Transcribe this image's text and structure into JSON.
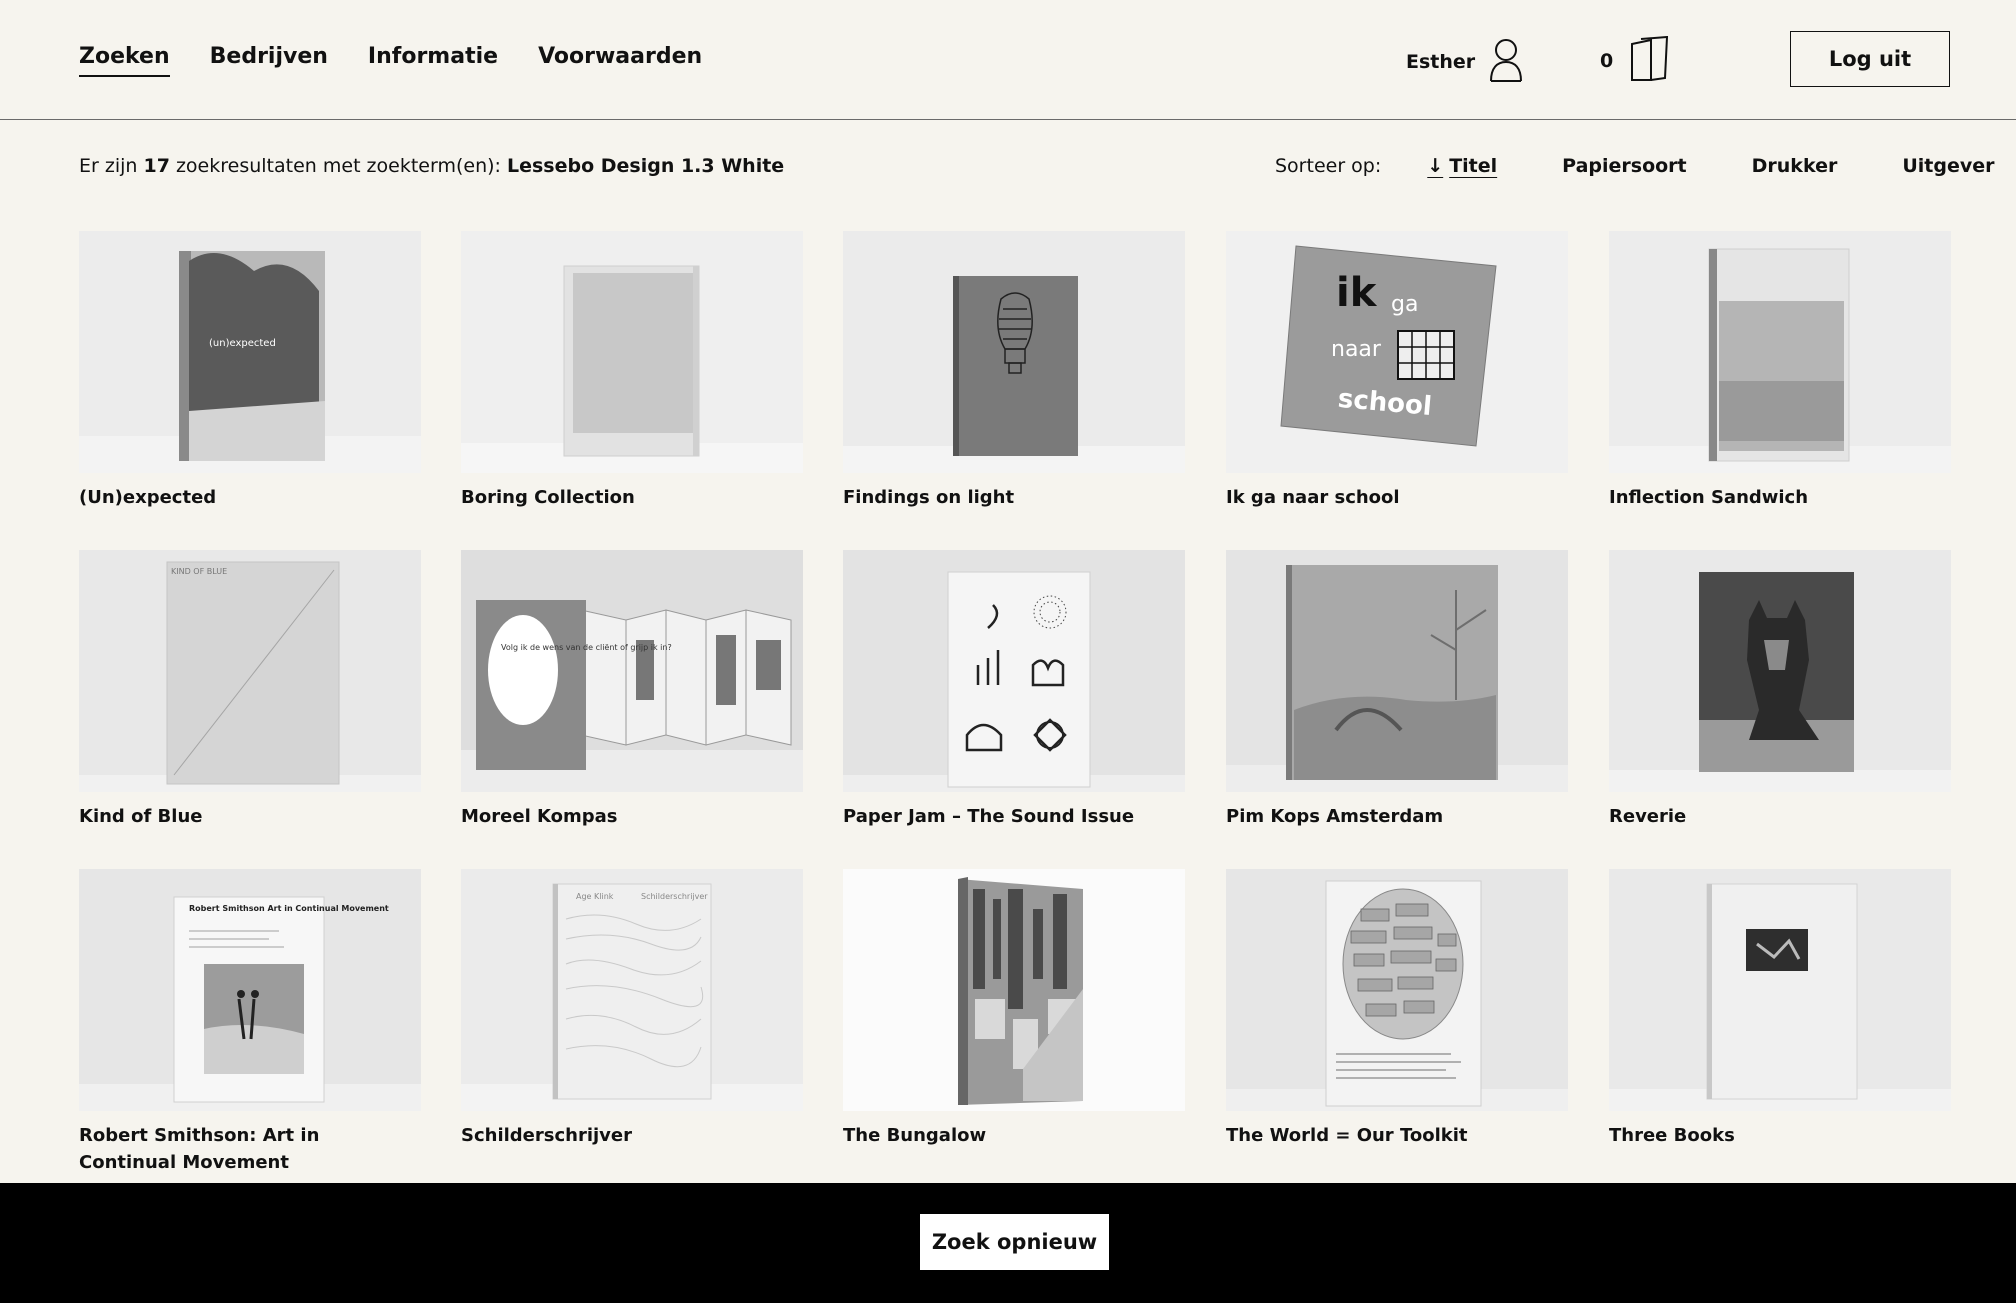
{
  "nav": {
    "items": [
      {
        "label": "Zoeken",
        "active": true
      },
      {
        "label": "Bedrijven",
        "active": false
      },
      {
        "label": "Informatie",
        "active": false
      },
      {
        "label": "Voorwaarden",
        "active": false
      }
    ]
  },
  "user": {
    "name": "Esther",
    "icon": "user-icon"
  },
  "cart": {
    "count": "0",
    "icon": "bookmark-cards-icon"
  },
  "header": {
    "logout_label": "Log uit"
  },
  "results": {
    "prefix": "Er zijn ",
    "count": "17",
    "middle": " zoekresultaten met zoekterm(en): ",
    "term": "Lessebo Design 1.3 White"
  },
  "sort": {
    "label": "Sorteer op:",
    "options": [
      {
        "label": "Titel",
        "active": true,
        "icon": "arrow-down-icon"
      },
      {
        "label": "Papiersoort",
        "active": false
      },
      {
        "label": "Drukker",
        "active": false
      },
      {
        "label": "Uitgever",
        "active": false
      }
    ]
  },
  "items": [
    {
      "title": "(Un)expected"
    },
    {
      "title": "Boring Collection"
    },
    {
      "title": "Findings on light"
    },
    {
      "title": "Ik ga naar school"
    },
    {
      "title": "Inflection Sandwich"
    },
    {
      "title": "Kind of Blue"
    },
    {
      "title": "Moreel Kompas"
    },
    {
      "title": "Paper Jam – The Sound Issue"
    },
    {
      "title": "Pim Kops Amsterdam"
    },
    {
      "title": "Reverie"
    },
    {
      "title": "Robert Smithson: Art in Continual Movement"
    },
    {
      "title": "Schilderschrijver"
    },
    {
      "title": "The Bungalow"
    },
    {
      "title": "The World = Our Toolkit"
    },
    {
      "title": "Three Books"
    }
  ],
  "cover_text": {
    "unexpected": "(un)expected",
    "ikga_1": "ik",
    "ikga_2": "ga",
    "ikga_3": "naar",
    "ikga_4": "school",
    "kindofblue": "KIND OF BLUE",
    "moreel": "Volg ik de wens van de cliënt of grijp ik in?",
    "smithson": "Robert Smithson Art in Continual Movement",
    "schilder_author": "Age Klink",
    "schilder_title": "Schilderschrijver"
  },
  "footer": {
    "search_again_label": "Zoek opnieuw"
  }
}
